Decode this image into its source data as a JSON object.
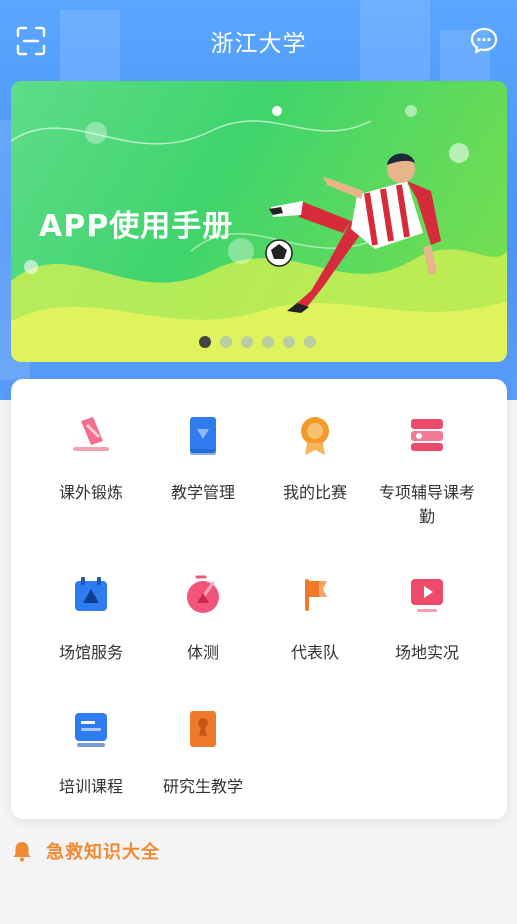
{
  "header": {
    "title": "浙江大学",
    "scan_icon": "scan-icon",
    "message_icon": "message-icon"
  },
  "banner": {
    "title": "APP使用手册",
    "slide_count": 6,
    "active_index": 0
  },
  "menu": {
    "items": [
      {
        "label": "课外锻炼",
        "icon": "exercise-icon",
        "color": "#f2557a"
      },
      {
        "label": "教学管理",
        "icon": "teaching-icon",
        "color": "#2f7cf0"
      },
      {
        "label": "我的比赛",
        "icon": "medal-icon",
        "color": "#f39a2b"
      },
      {
        "label": "专项辅导课考勤",
        "icon": "attendance-icon",
        "color": "#ee4a6b"
      },
      {
        "label": "场馆服务",
        "icon": "venue-icon",
        "color": "#2f7cf0"
      },
      {
        "label": "体测",
        "icon": "fitness-test-icon",
        "color": "#f2557a"
      },
      {
        "label": "代表队",
        "icon": "flag-icon",
        "color": "#f07a2b"
      },
      {
        "label": "场地实况",
        "icon": "live-video-icon",
        "color": "#ee4a6b"
      },
      {
        "label": "培训课程",
        "icon": "course-icon",
        "color": "#2f7cf0"
      },
      {
        "label": "研究生教学",
        "icon": "graduate-icon",
        "color": "#f07a2b"
      }
    ]
  },
  "notice": {
    "label": "急救知识大全",
    "icon": "bell-icon",
    "color": "#f08a30"
  }
}
